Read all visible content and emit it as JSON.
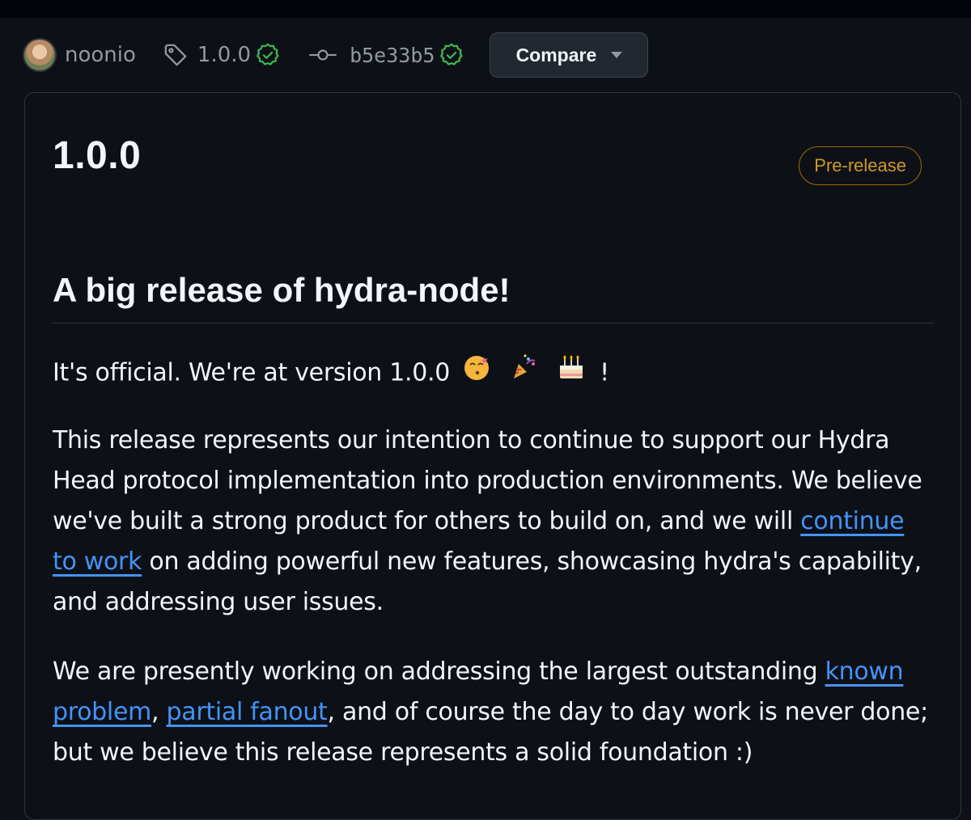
{
  "author": {
    "name": "noonio"
  },
  "tag": {
    "name": "1.0.0"
  },
  "commit": {
    "sha": "b5e33b5"
  },
  "compare_button": {
    "label": "Compare"
  },
  "release": {
    "title": "1.0.0",
    "badge": "Pre-release",
    "heading": "A big release of hydra-node!",
    "p1_text": "It's official. We're at version 1.0.0",
    "p1_end": "!",
    "p2_a": "This release represents our intention to continue to support our Hydra Head protocol implementation into production environments. We believe we've built a strong product for others to build on, and we will ",
    "p2_link": "continue to work",
    "p2_b": " on adding powerful new features, showcasing hydra's capability, and addressing user issues.",
    "p3_a": "We are presently working on addressing the largest outstanding ",
    "p3_link1": "known problem",
    "p3_sep": ", ",
    "p3_link2": "partial fanout",
    "p3_b": ", and of course the day to day work is never done; but we believe this release represents a solid foundation :)"
  },
  "icons": {
    "tag": "tag-icon",
    "verified": "verified-check-icon",
    "commit": "git-commit-icon",
    "caret": "caret-down-icon",
    "emojis": [
      "kissing-face-emoji",
      "party-popper-emoji",
      "birthday-cake-emoji"
    ]
  },
  "colors": {
    "background": "#0d1117",
    "link": "#4493f8",
    "verified": "#3fb950",
    "prerelease": "#d29922"
  }
}
